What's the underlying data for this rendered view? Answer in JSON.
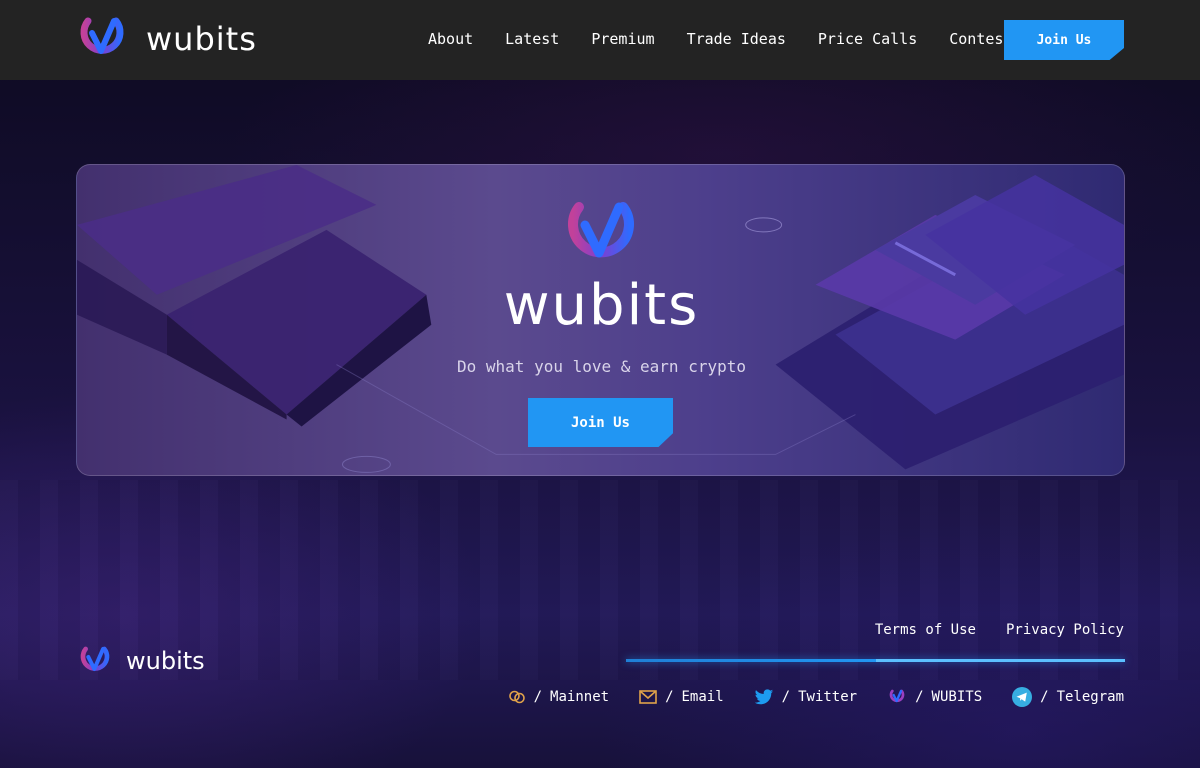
{
  "header": {
    "brand_name": "wubits",
    "nav": [
      "About",
      "Latest",
      "Premium",
      "Trade Ideas",
      "Price Calls",
      "Contests"
    ],
    "join_label": "Join Us"
  },
  "hero": {
    "brand_name": "wubits",
    "tagline": "Do what you love & earn crypto",
    "join_label": "Join Us"
  },
  "footer": {
    "brand_name": "wubits",
    "legal": [
      "Terms of Use",
      "Privacy Policy"
    ],
    "separator": "/",
    "socials": [
      {
        "label": "Mainnet",
        "icon": "mainnet-icon"
      },
      {
        "label": "Email",
        "icon": "email-icon"
      },
      {
        "label": "Twitter",
        "icon": "twitter-icon"
      },
      {
        "label": "WUBITS",
        "icon": "wubits-icon"
      },
      {
        "label": "Telegram",
        "icon": "telegram-icon"
      }
    ]
  },
  "colors": {
    "accent": "#2196f3",
    "header_bg": "#232323",
    "logo_pink": "#c2419a",
    "logo_blue": "#2f6bff"
  }
}
